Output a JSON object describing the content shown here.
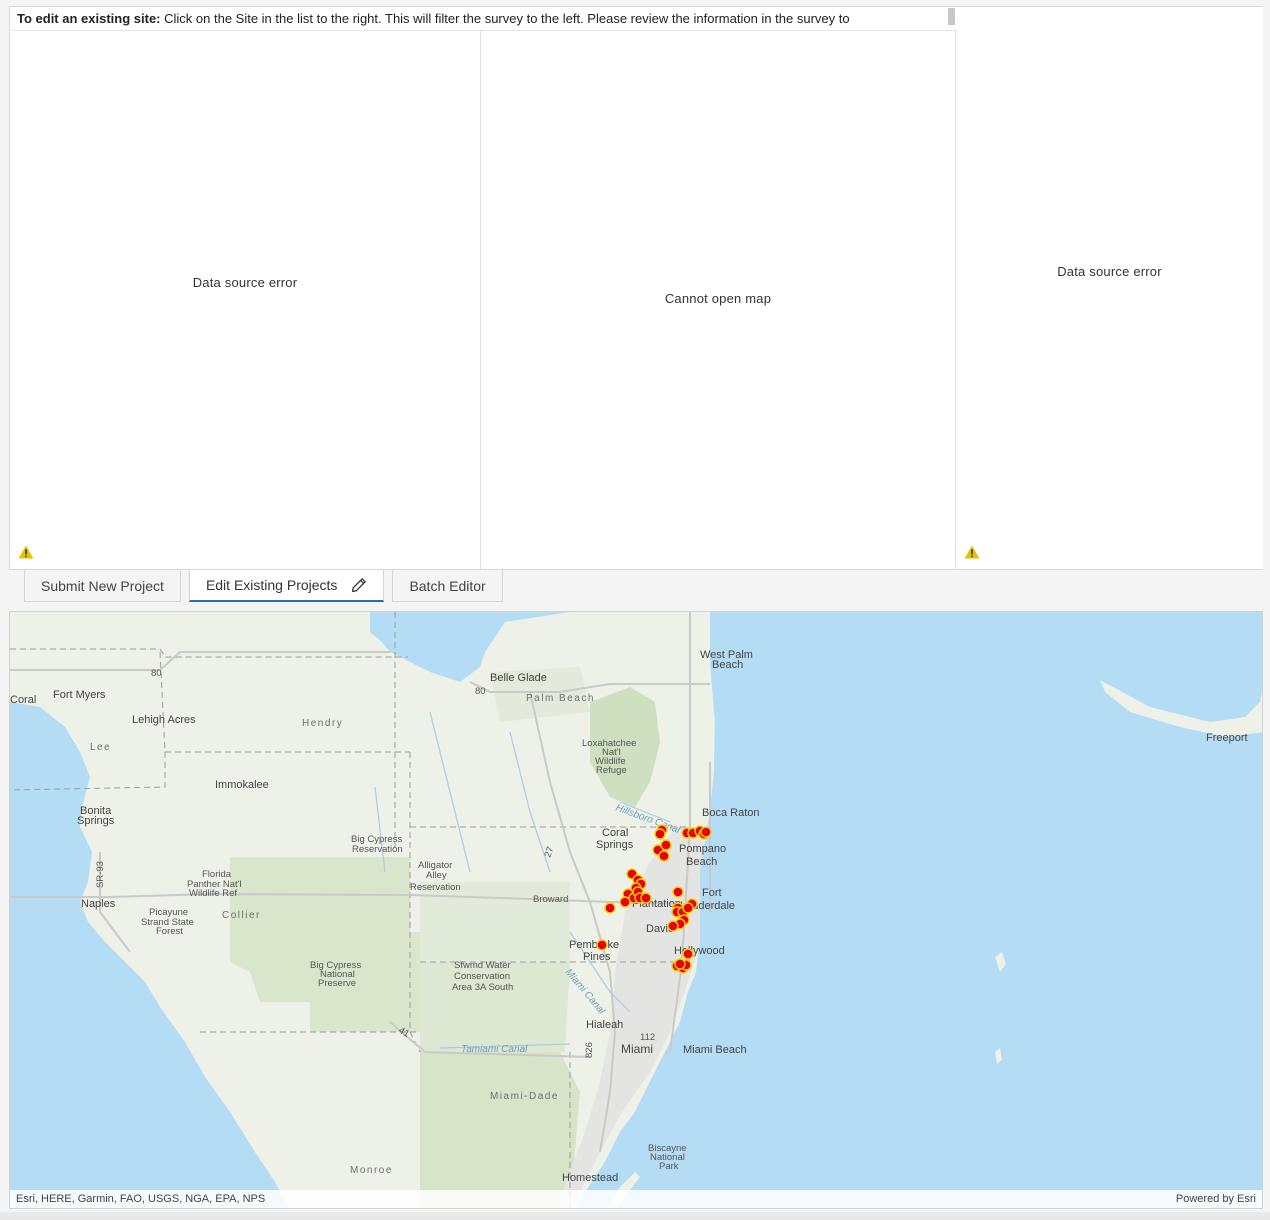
{
  "instruction": {
    "bold": "To edit an existing site:",
    "text": " Click on the Site in the list to the right. This will filter the survey to the left. Please review the information in the survey to"
  },
  "panes": {
    "left_message": "Data source error",
    "middle_message": "Cannot open map",
    "right_message": "Data source error"
  },
  "tabs": [
    {
      "label": "Submit New Project"
    },
    {
      "label": "Edit Existing Projects"
    },
    {
      "label": "Batch Editor"
    }
  ],
  "map": {
    "attribution": "Esri, HERE, Garmin, FAO, USGS, NGA, EPA, NPS",
    "powered_by": "Powered by Esri",
    "labels": {
      "west_palm_1": "West Palm",
      "west_palm_2": "Beach",
      "belle_glade": "Belle Glade",
      "palm_beach": "Palm Beach",
      "coral": "Coral",
      "fort_myers": "Fort Myers",
      "lehigh": "Lehigh Acres",
      "hendry": "Hendry",
      "lee": "Lee",
      "lox_1": "Loxahatchee",
      "lox_2": "Nat'l",
      "lox_3": "Wildlife",
      "lox_4": "Refuge",
      "freeport": "Freeport",
      "immokalee": "Immokalee",
      "bonita_1": "Bonita",
      "bonita_2": "Springs",
      "hillsboro": "Hillsboro Canal",
      "boca": "Boca Raton",
      "coral_springs_1": "Coral",
      "coral_springs_2": "Springs",
      "pompano_1": "Pompano",
      "pompano_2": "Beach",
      "bigcyp_res_1": "Big Cypress",
      "bigcyp_res_2": "Reservation",
      "alligator_1": "Alligator",
      "alligator_2": "Alley",
      "alligator_3": "Reservation",
      "panther_1": "Florida",
      "panther_2": "Panther Nat'l",
      "panther_3": "Wildlife Ref",
      "fort_laud_1": "Fort",
      "fort_laud_2": "Lauderdale",
      "sr93": "SR-93",
      "naples": "Naples",
      "collier": "Collier",
      "picayune_1": "Picayune",
      "picayune_2": "Strand State",
      "picayune_3": "Forest",
      "broward": "Broward",
      "plantation": "Plantation",
      "davie": "Davie",
      "pembroke_1": "Pembroke",
      "pembroke_2": "Pines",
      "hollywood": "Hollywood",
      "bigcyp_pres_1": "Big Cypress",
      "bigcyp_pres_2": "National",
      "bigcyp_pres_3": "Preserve",
      "sfwmd_1": "Sfwmd Water",
      "sfwmd_2": "Conservation",
      "sfwmd_3": "Area 3A South",
      "miami_canal": "Miami Canal",
      "hialeah": "Hialeah",
      "miami": "Miami",
      "miami_beach": "Miami Beach",
      "tamiami": "Tamiami Canal",
      "miami_dade": "Miami-Dade",
      "biscayne_1": "Biscayne",
      "biscayne_2": "National",
      "biscayne_3": "Park",
      "monroe": "Monroe",
      "homestead": "Homestead",
      "rt80a": "80",
      "rt80b": "80",
      "rt27": "27",
      "rt41": "41",
      "rt112": "112",
      "rt826": "826"
    }
  },
  "colors": {
    "accent": "#2a6bb3",
    "marker_fill": "#e8000b",
    "marker_stroke": "#f5d200",
    "warning": "#e6c200",
    "water": "#b4dcf5",
    "land": "#eef1e8"
  }
}
